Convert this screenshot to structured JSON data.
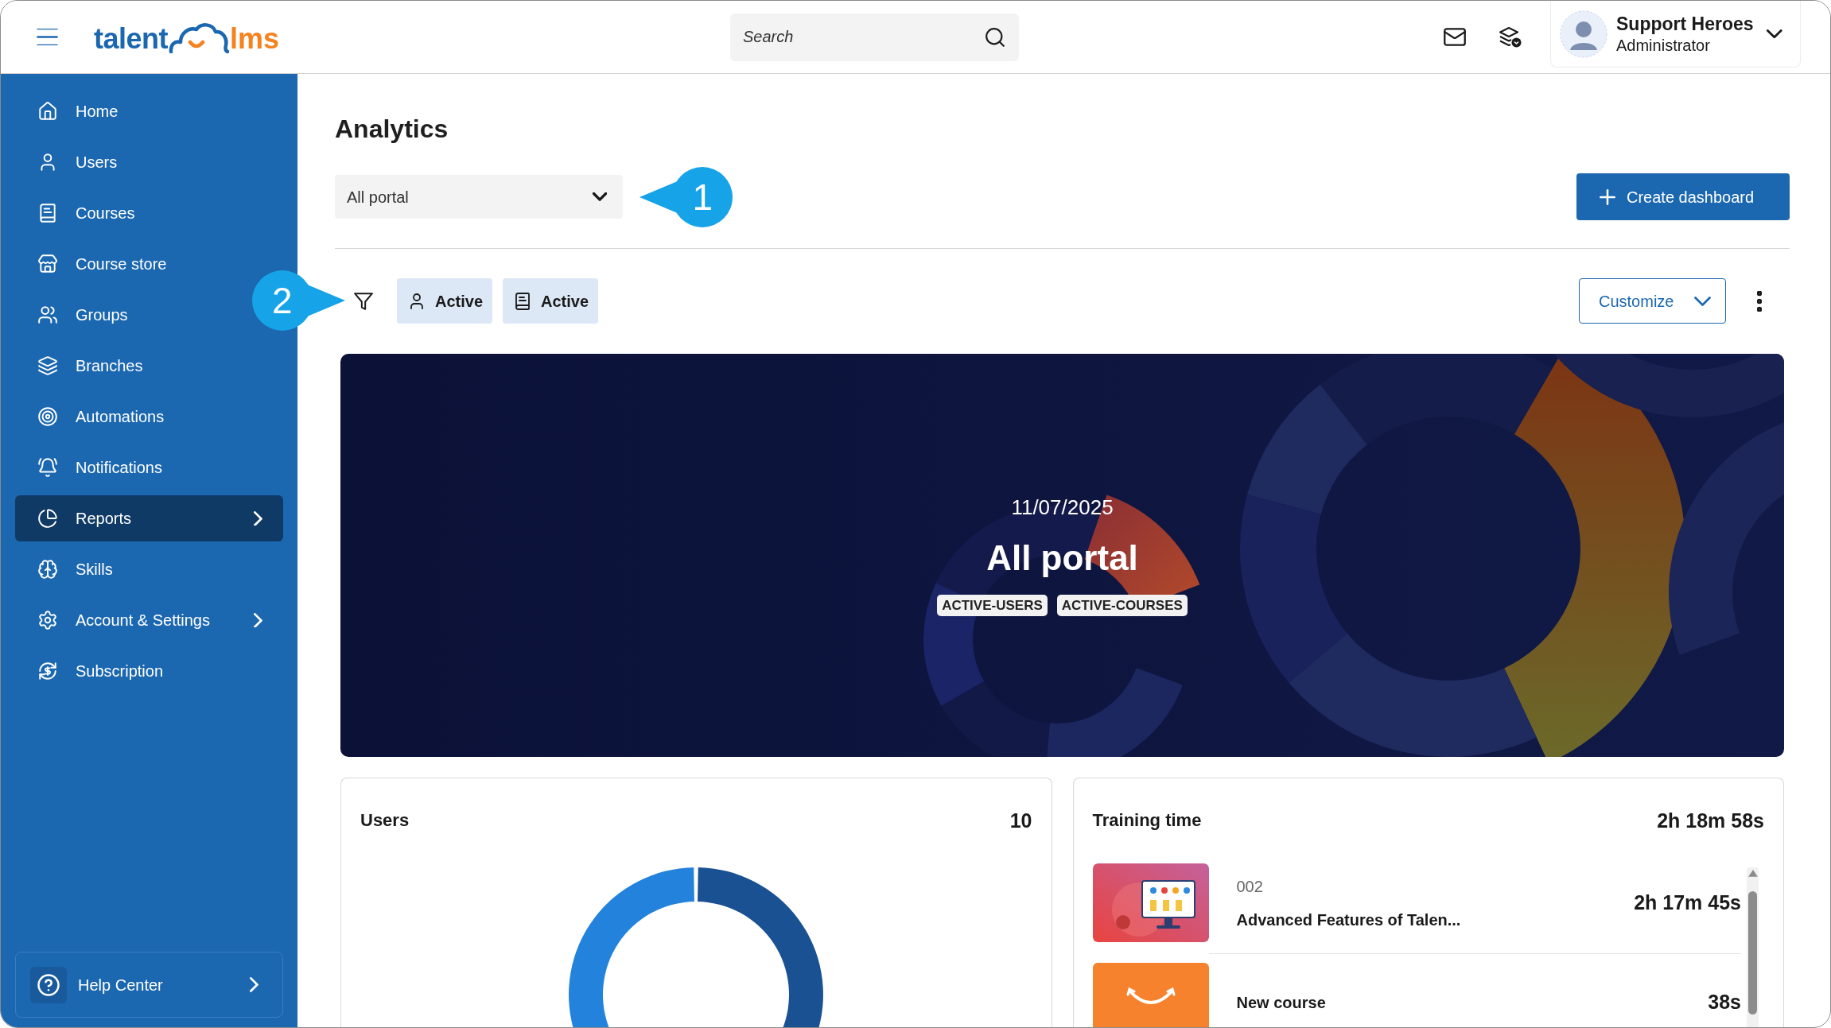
{
  "header": {
    "logo": {
      "primary": "talent",
      "secondary": "lms"
    },
    "search": {
      "placeholder": "Search"
    },
    "user": {
      "name": "Support Heroes",
      "role": "Administrator"
    }
  },
  "sidebar": {
    "items": [
      {
        "label": "Home",
        "selected": false,
        "has_submenu": false
      },
      {
        "label": "Users",
        "selected": false,
        "has_submenu": false
      },
      {
        "label": "Courses",
        "selected": false,
        "has_submenu": false
      },
      {
        "label": "Course store",
        "selected": false,
        "has_submenu": false
      },
      {
        "label": "Groups",
        "selected": false,
        "has_submenu": false
      },
      {
        "label": "Branches",
        "selected": false,
        "has_submenu": false
      },
      {
        "label": "Automations",
        "selected": false,
        "has_submenu": false
      },
      {
        "label": "Notifications",
        "selected": false,
        "has_submenu": false
      },
      {
        "label": "Reports",
        "selected": true,
        "has_submenu": true
      },
      {
        "label": "Skills",
        "selected": false,
        "has_submenu": false
      },
      {
        "label": "Account & Settings",
        "selected": false,
        "has_submenu": true
      },
      {
        "label": "Subscription",
        "selected": false,
        "has_submenu": false
      }
    ],
    "help": {
      "label": "Help Center"
    }
  },
  "page": {
    "title": "Analytics",
    "dashboard_select": {
      "value": "All portal"
    },
    "create_button": {
      "label": "Create dashboard"
    },
    "filters": [
      {
        "kind": "users",
        "label": "Active"
      },
      {
        "kind": "courses",
        "label": "Active"
      }
    ],
    "customize_button": {
      "label": "Customize"
    }
  },
  "banner": {
    "date": "11/07/2025",
    "title": "All portal",
    "tags": [
      "ACTIVE-USERS",
      "ACTIVE-COURSES"
    ]
  },
  "widgets": [
    {
      "kind": "donut",
      "title": "Users",
      "value": "10"
    },
    {
      "kind": "list",
      "title": "Training time",
      "value": "2h 18m 58s",
      "rows": [
        {
          "kind": "image",
          "code": "002",
          "name": "Advanced Features of Talen...",
          "time": "2h 17m 45s"
        },
        {
          "kind": "logo",
          "name": "New course",
          "time": "38s"
        }
      ]
    }
  ],
  "annotations": [
    {
      "label": "1",
      "kind": "left"
    },
    {
      "label": "2",
      "kind": "right"
    }
  ]
}
